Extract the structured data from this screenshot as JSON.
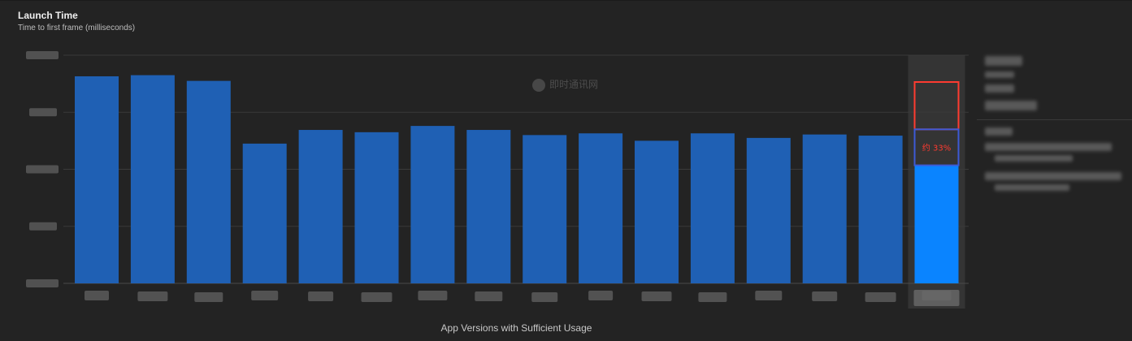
{
  "header": {
    "title": "Launch Time",
    "subtitle": "Time to first frame (milliseconds)"
  },
  "watermark": {
    "text": "即时通讯网"
  },
  "annotation": {
    "text": "约 33%"
  },
  "colors": {
    "bar": "#1f60b4",
    "highlight_bar": "#0a84ff",
    "highlight_band": "#343434",
    "annotation_red": "#ff3b30",
    "annotation_blue": "#3d5ad6",
    "gridline": "#3a3a3a"
  },
  "chart_data": {
    "type": "bar",
    "title": "Launch Time",
    "subtitle": "Time to first frame (milliseconds)",
    "xlabel": "App Versions with Sufficient Usage",
    "ylabel": "",
    "ylim": [
      0,
      4
    ],
    "gridlines": [
      0,
      1,
      2,
      3,
      4
    ],
    "grid": true,
    "tick_labels_obscured": true,
    "values": [
      3.63,
      3.65,
      3.55,
      2.45,
      2.69,
      2.65,
      2.76,
      2.69,
      2.6,
      2.63,
      2.5,
      2.63,
      2.55,
      2.61,
      2.59,
      2.07
    ],
    "highlight_index": 15,
    "highlight_bracket_top": 3.53,
    "highlight_bracket_mid": 2.7
  }
}
